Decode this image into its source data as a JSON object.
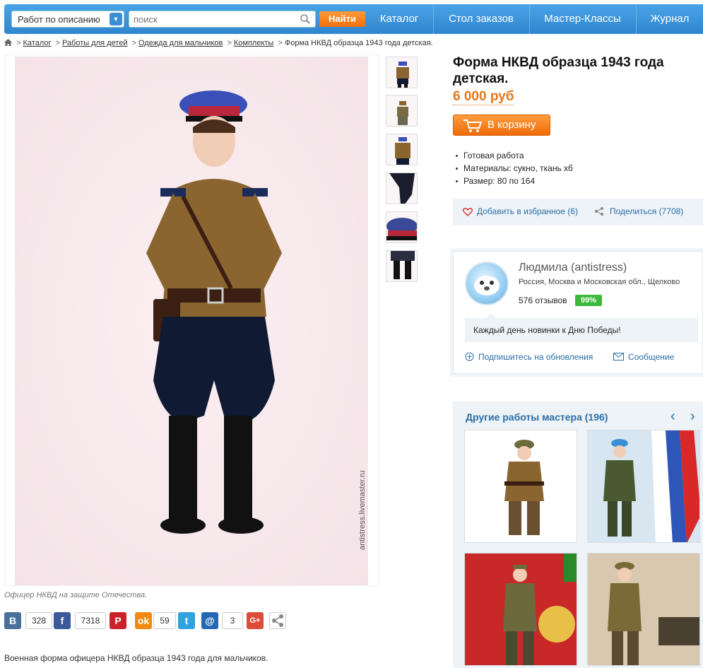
{
  "header": {
    "select_label": "Работ по описанию",
    "search_placeholder": "поиск",
    "find_label": "Найти",
    "nav": [
      "Каталог",
      "Стол заказов",
      "Мастер-Классы",
      "Журнал"
    ]
  },
  "breadcrumb": {
    "items": [
      "Каталог",
      "Работы для детей",
      "Одежда для мальчиков",
      "Комплекты"
    ],
    "current": "Форма НКВД образца 1943 года детская."
  },
  "photo": {
    "watermark": "antistress.livemaster.ru",
    "caption": "Офицер НКВД на защите Отечества."
  },
  "social": {
    "vk_count": "328",
    "fb_count": "7318",
    "ok_count": "59",
    "mail_count": "3"
  },
  "description": "Военная форма офицера НКВД образца 1943 года для мальчиков.",
  "product": {
    "title": "Форма НКВД образца 1943 года детская.",
    "price": "6 000 руб",
    "cart_label": "В корзину",
    "props": [
      "Готовая работа",
      "Материалы: сукно, ткань хб",
      "Размер: 80 по 164"
    ],
    "favorite_label": "Добавить в избранное (6)",
    "share_label": "Поделиться (7708)"
  },
  "master": {
    "name": "Людмила (antistress)",
    "location": "Россия, Москва и Московская обл., Щелково",
    "reviews": "576 отзывов",
    "rating": "99%",
    "note": "Каждый день новинки к Дню Победы!",
    "subscribe_label": "Подпишитесь на обновления",
    "message_label": "Сообщение"
  },
  "other_works": {
    "title": "Другие работы мастера (196)",
    "prev": "‹",
    "next": "›"
  },
  "colors": {
    "nav_blue": "#2f86cf",
    "accent_orange": "#f0700a",
    "link_blue": "#2a6ea8",
    "rating_green": "#3cb83c"
  }
}
